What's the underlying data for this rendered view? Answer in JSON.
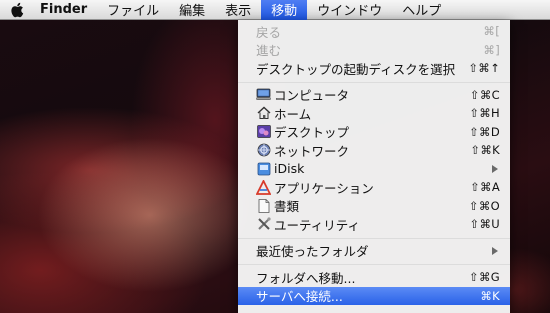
{
  "menubar": {
    "apple_icon": "apple-icon",
    "items": [
      {
        "label": "Finder"
      },
      {
        "label": "ファイル"
      },
      {
        "label": "編集"
      },
      {
        "label": "表示"
      },
      {
        "label": "移動"
      },
      {
        "label": "ウインドウ"
      },
      {
        "label": "ヘルプ"
      }
    ]
  },
  "go_menu": {
    "back": {
      "label": "戻る",
      "shortcut": "⌘["
    },
    "forward": {
      "label": "進む",
      "shortcut": "⌘]"
    },
    "startup_disk": {
      "label": "デスクトップの起動ディスクを選択",
      "shortcut": "⇧⌘↑"
    },
    "places": [
      {
        "label": "コンピュータ",
        "shortcut": "⇧⌘C",
        "icon": "computer-icon"
      },
      {
        "label": "ホーム",
        "shortcut": "⇧⌘H",
        "icon": "home-icon"
      },
      {
        "label": "デスクトップ",
        "shortcut": "⇧⌘D",
        "icon": "desktop-icon"
      },
      {
        "label": "ネットワーク",
        "shortcut": "⇧⌘K",
        "icon": "network-icon"
      },
      {
        "label": "iDisk",
        "shortcut": "",
        "icon": "idisk-icon"
      },
      {
        "label": "アプリケーション",
        "shortcut": "⇧⌘A",
        "icon": "applications-icon"
      },
      {
        "label": "書類",
        "shortcut": "⇧⌘O",
        "icon": "documents-icon"
      },
      {
        "label": "ユーティリティ",
        "shortcut": "⇧⌘U",
        "icon": "utilities-icon"
      }
    ],
    "recent_folders": {
      "label": "最近使ったフォルダ"
    },
    "goto_folder": {
      "label": "フォルダへ移動...",
      "shortcut": "⇧⌘G"
    },
    "connect_server": {
      "label": "サーバへ接続...",
      "shortcut": "⌘K"
    }
  },
  "colors": {
    "highlight": "#2a62e8",
    "disabled_text": "#a5a5a5"
  }
}
